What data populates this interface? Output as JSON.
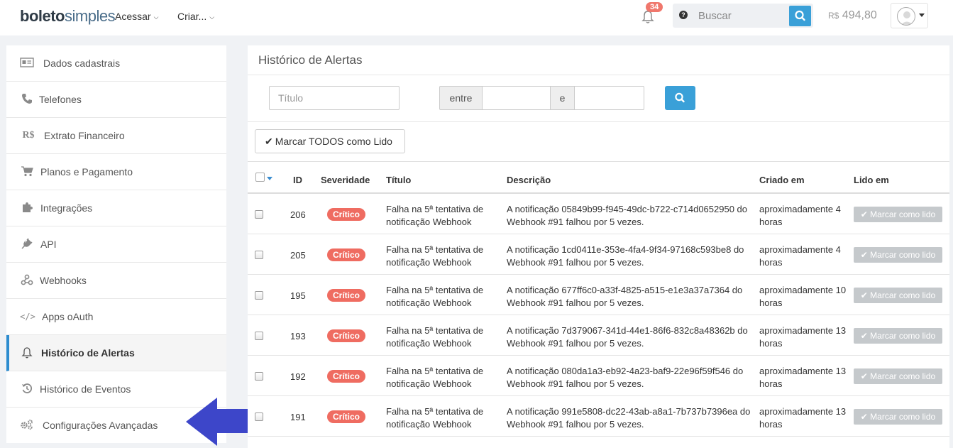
{
  "header": {
    "logo_bold": "boleto",
    "logo_light": "simples",
    "nav": [
      {
        "label": "Acessar"
      },
      {
        "label": "Criar..."
      }
    ],
    "notifications_count": "34",
    "search_placeholder": "Buscar",
    "balance_currency": "R$",
    "balance_value": "494,80"
  },
  "sidebar": {
    "items": [
      {
        "label": "Dados cadastrais",
        "icon": "id-card-icon"
      },
      {
        "label": "Telefones",
        "icon": "phone-icon"
      },
      {
        "label": "Extrato Financeiro",
        "icon": "currency-icon",
        "glyph": "R$"
      },
      {
        "label": "Planos e Pagamento",
        "icon": "cart-icon"
      },
      {
        "label": "Integrações",
        "icon": "puzzle-icon"
      },
      {
        "label": "API",
        "icon": "plug-icon"
      },
      {
        "label": "Webhooks",
        "icon": "webhook-icon"
      },
      {
        "label": "Apps oAuth",
        "icon": "code-icon",
        "glyph": "</>"
      },
      {
        "label": "Histórico de Alertas",
        "icon": "bell-icon",
        "active": true
      },
      {
        "label": "Histórico de Eventos",
        "icon": "history-icon"
      },
      {
        "label": "Configurações Avançadas",
        "icon": "gears-icon"
      }
    ]
  },
  "main": {
    "title": "Histórico de Alertas",
    "filters": {
      "title_placeholder": "Título",
      "between_label": "entre",
      "and_label": "e"
    },
    "mark_all_label": "Marcar TODOS como Lido",
    "table": {
      "headers": {
        "id": "ID",
        "severity": "Severidade",
        "title": "Título",
        "description": "Descrição",
        "created": "Criado em",
        "read": "Lido em"
      },
      "mark_read_label": "Marcar como lido",
      "rows": [
        {
          "id": "206",
          "severity": "Crítico",
          "title": "Falha na 5ª tentativa de notificação Webhook",
          "description": "A notificação 05849b99-f945-49dc-b722-c714d0652950 do Webhook #91 falhou por 5 vezes.",
          "created": "aproximadamente 4 horas"
        },
        {
          "id": "205",
          "severity": "Crítico",
          "title": "Falha na 5ª tentativa de notificação Webhook",
          "description": "A notificação 1cd0411e-353e-4fa4-9f34-97168c593be8 do Webhook #91 falhou por 5 vezes.",
          "created": "aproximadamente 4 horas"
        },
        {
          "id": "195",
          "severity": "Crítico",
          "title": "Falha na 5ª tentativa de notificação Webhook",
          "description": "A notificação 677ff6c0-a33f-4825-a515-e1e3a37a7364 do Webhook #91 falhou por 5 vezes.",
          "created": "aproximadamente 10 horas"
        },
        {
          "id": "193",
          "severity": "Crítico",
          "title": "Falha na 5ª tentativa de notificação Webhook",
          "description": "A notificação 7d379067-341d-44e1-86f6-832c8a48362b do Webhook #91 falhou por 5 vezes.",
          "created": "aproximadamente 13 horas"
        },
        {
          "id": "192",
          "severity": "Crítico",
          "title": "Falha na 5ª tentativa de notificação Webhook",
          "description": "A notificação 080da1a3-eb92-4a23-baf9-22e96f59f546 do Webhook #91 falhou por 5 vezes.",
          "created": "aproximadamente 13 horas"
        },
        {
          "id": "191",
          "severity": "Crítico",
          "title": "Falha na 5ª tentativa de notificação Webhook",
          "description": "A notificação 991e5808-dc22-43ab-a8a1-7b737b7396ea do Webhook #91 falhou por 5 vezes.",
          "created": "aproximadamente 13 horas"
        }
      ]
    }
  },
  "colors": {
    "accent": "#3aa0d8",
    "critical": "#ef6c61",
    "active_border": "#2d8ccf",
    "arrow": "#3d46c9"
  }
}
